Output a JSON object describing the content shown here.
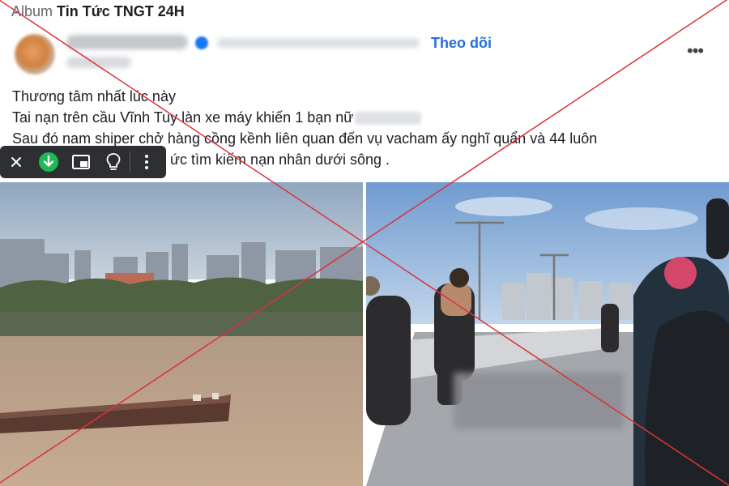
{
  "album": {
    "prefix": "Album",
    "name": "Tin Tức TNGT 24H"
  },
  "header": {
    "follow_label": "Theo dõi",
    "more_label": "•••"
  },
  "post": {
    "lines": [
      "Thương tâm nhất lúc này",
      "Tai nạn trên cầu Vĩnh Tuy làn xe máy khiến 1 bạn nữ",
      "Sau đó nam shiper chở hàng cồng kềnh liên quan đến vụ vacham ấy nghĩ quẩn và 44 luôn",
      "ức tìm kiếm nạn nhân dưới sông ."
    ]
  },
  "toolbar": {
    "icons": [
      "close-icon",
      "download-icon",
      "picture-in-picture-icon",
      "lightbulb-icon",
      "more-vertical-icon"
    ],
    "accent": "#1db954"
  },
  "photos": {
    "left": "river-barge-photo",
    "right": "bridge-accident-photo"
  },
  "watermark": {
    "color": "#d9333f",
    "type": "red-x-cross"
  }
}
